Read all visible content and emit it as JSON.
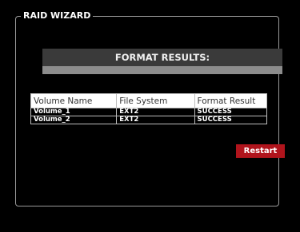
{
  "wizard": {
    "legend": "RAID WIZARD"
  },
  "results": {
    "title": "FORMAT RESULTS:",
    "columns": [
      "Volume Name",
      "File System",
      "Format Result"
    ],
    "rows": [
      [
        "Volume_1",
        "EXT2",
        "SUCCESS"
      ],
      [
        "Volume_2",
        "EXT2",
        "SUCCESS"
      ]
    ]
  },
  "actions": {
    "restart_label": "Restart"
  },
  "colors": {
    "background": "#000000",
    "title_bar": "#3a3a3a",
    "accent_button": "#b0141c"
  }
}
